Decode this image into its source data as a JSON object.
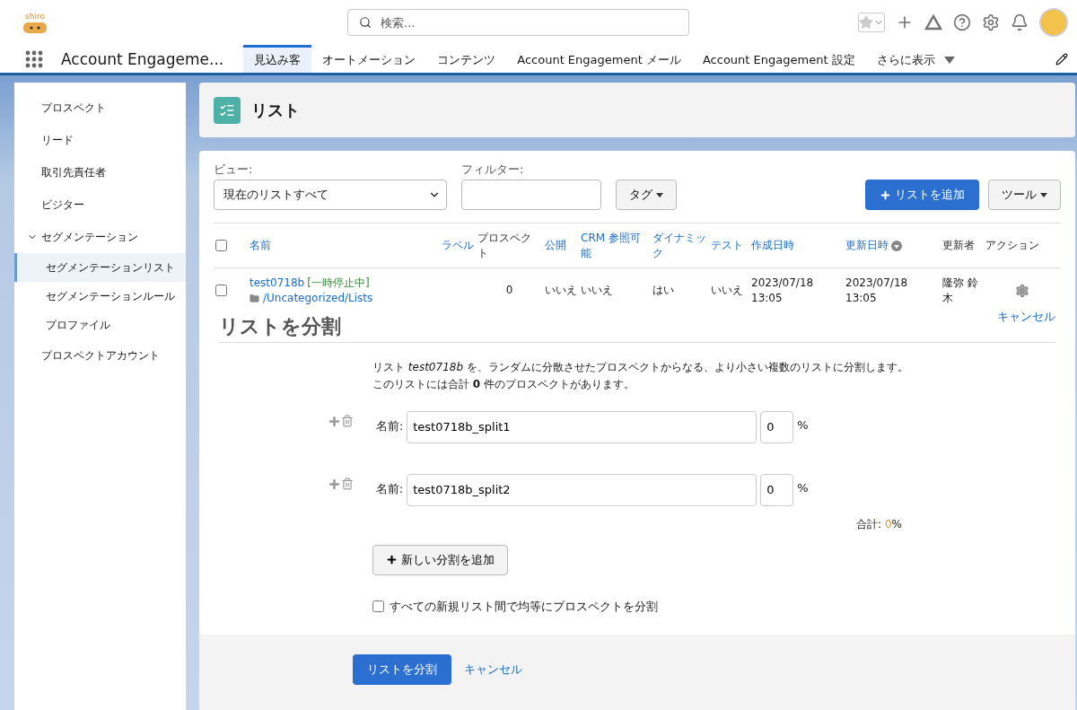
{
  "header": {
    "logo_text": "shiro",
    "search": {
      "placeholder": "検索..."
    }
  },
  "nav": {
    "app_name": "Account Engageme...",
    "tabs": [
      {
        "label": "見込み客",
        "selected": true
      },
      {
        "label": "オートメーション",
        "selected": false
      },
      {
        "label": "コンテンツ",
        "selected": false
      },
      {
        "label": "Account Engagement メール",
        "selected": false
      },
      {
        "label": "Account Engagement 設定",
        "selected": false
      },
      {
        "label": "さらに表示",
        "selected": false,
        "kind": "more"
      }
    ]
  },
  "sidebar": {
    "items": [
      {
        "label": "プロスペクト",
        "selected": false
      },
      {
        "label": "リード",
        "selected": false
      },
      {
        "label": "取引先責任者",
        "selected": false
      },
      {
        "label": "ビジター",
        "selected": false
      },
      {
        "label": "セグメンテーション",
        "selected": false,
        "expanded": true,
        "children": [
          {
            "label": "セグメンテーションリスト",
            "selected": true
          },
          {
            "label": "セグメンテーションルール",
            "selected": false
          },
          {
            "label": "プロファイル",
            "selected": false
          }
        ]
      },
      {
        "label": "プロスペクトアカウント",
        "selected": false
      }
    ]
  },
  "page_title": "リスト",
  "filters": {
    "view_label": "ビュー:",
    "view_value": "現在のリストすべて",
    "filter_label": "フィルター:",
    "tag_button": "タグ",
    "add_button": "リストを追加",
    "tools_button": "ツール"
  },
  "table": {
    "select_all_checked": false,
    "columns": [
      {
        "label": "名前",
        "link": true
      },
      {
        "label": "ラベル",
        "link": true
      },
      {
        "label": "プロスペクト",
        "link": false
      },
      {
        "label": "公開",
        "link": true
      },
      {
        "label": "CRM 参照可能",
        "link": true
      },
      {
        "label": "ダイナミック",
        "link": true
      },
      {
        "label": "テスト",
        "link": true
      },
      {
        "label": "作成日時",
        "link": true
      },
      {
        "label": "更新日時",
        "link": true,
        "sorted": true
      },
      {
        "label": "更新者",
        "link": false
      },
      {
        "label": "アクション",
        "link": false
      }
    ],
    "rows": [
      {
        "checked": false,
        "status": "[一時停止中]",
        "folder": "/Uncategorized/Lists",
        "cells": [
          "test0718b",
          "",
          "0",
          "いいえ",
          "いいえ",
          "はい",
          "いいえ",
          "2023/07/18 13:05",
          "2023/07/18 13:05",
          "隆弥 鈴木"
        ]
      }
    ]
  },
  "split": {
    "title": "リストを分割",
    "cancel_link": "キャンセル",
    "description": [
      "リスト *test0718b* を、ランダムに分散させたプロスペクトからなる、より小さい複数のリストに分割します。",
      "このリストには合計 **0** 件のプロスペクトがあります。"
    ],
    "rows": [
      {
        "label": "名前:",
        "name": "test0718b_split1",
        "percent": "0",
        "unit": "%"
      },
      {
        "label": "名前:",
        "name": "test0718b_split2",
        "percent": "0",
        "unit": "%"
      }
    ],
    "total_label": "合計:",
    "total_value": "0",
    "total_unit": "%",
    "add_split_button": "新しい分割を追加",
    "even_split": {
      "label": "すべての新規リスト間で均等にプロスペクトを分割",
      "checked": false
    },
    "submit_button": "リストを分割",
    "footer_cancel": "キャンセル"
  }
}
